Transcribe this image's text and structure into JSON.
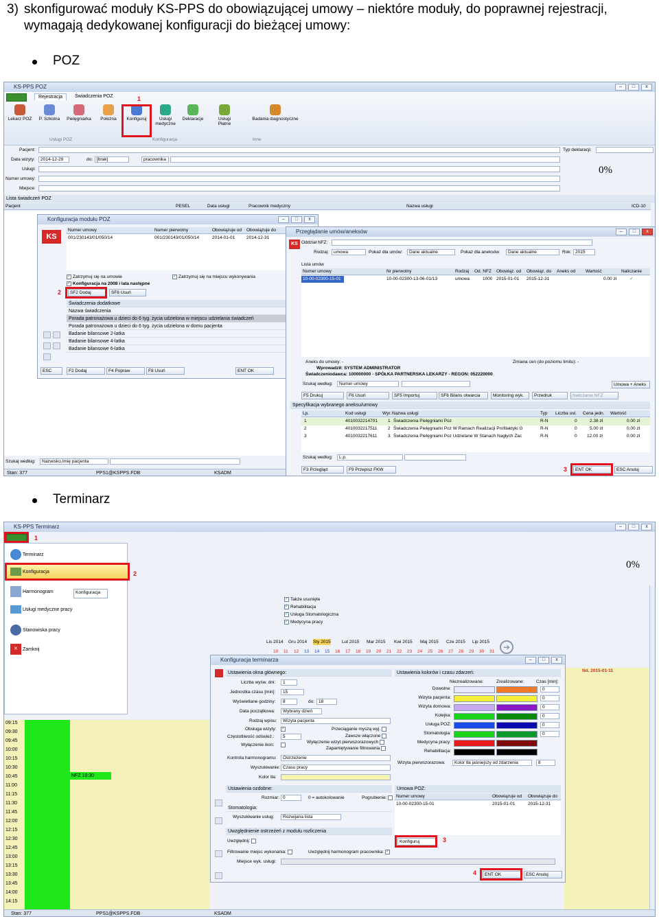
{
  "heading": {
    "number": "3)",
    "text": "skonfigurować moduły KS-PPS do obowiązującej umowy – niektóre moduły, do poprawnej rejestracji, wymagają dedykowanej konfiguracji do bieżącej umowy:"
  },
  "bullets": [
    "POZ",
    "Terminarz"
  ],
  "shot1": {
    "title": "KS-PPS POZ",
    "tabs": [
      "Rejestracja",
      "Świadczenia POZ"
    ],
    "ribbon_buttons": [
      "Lekarz POZ",
      "P. Szkolna",
      "Pielęgniarka",
      "Położna",
      "Konfiguruj",
      "Usługi medyczne",
      "Deklaracje",
      "Usługi Płatne",
      "Badania diagnostyczne"
    ],
    "groups": [
      "Usługi POZ",
      "Konfiguracja",
      "Inne"
    ],
    "form_labels": [
      "Pacjent:",
      "Data wizyty:",
      "Usługi:",
      "Numer umowy:",
      "Miejsce:"
    ],
    "date_from": "2014-12-29",
    "date_to_label": "do:",
    "date_to": "[brak]",
    "pracownik": "pracownika",
    "typ_deklaracji": "Typ deklaracji:",
    "percent": "0%",
    "list_title": "Lista świadczeń POZ",
    "list_cols": [
      "Pacjent",
      "PESEL",
      "Data usługi",
      "Pracownik medyczny",
      "Nazwa usługi",
      "ICD-10"
    ],
    "search_label": "Szukaj według:",
    "search_value": "Nazwisko,Imię pacjenta",
    "status": [
      "Stan: 377",
      "PPS1@KSPPS.FDB",
      "KSADM"
    ],
    "config": {
      "title": "Konfiguracja modułu POZ",
      "cols": [
        "Numer umowy",
        "Numer pierwotny",
        "Obowiązuje od",
        "Obowiązuje do"
      ],
      "row": [
        "001/230143/01/050/14",
        "001/230143/01/050/14",
        "2014-01-01",
        "2014-12-31"
      ],
      "chk1": "Zatrzymuj się na umowie",
      "chk2": "Zatrzymuj się na miejscu wykonywania",
      "chk3": "Konfiguracja na 2008 i lata następne",
      "add_btn": "SF2 Dodaj",
      "del_btn": "SF8 Usuń",
      "section": "Świadczenia dodatkowe",
      "list_hdr": "Nazwa świadczenia",
      "items": [
        "Porada patronażowa u dzieci do 6 tyg. życia udzielona w miejscu udzielania świadczeń",
        "Porada patronażowa u dzieci do 6 tyg. życia udzielona w domu pacjenta",
        "Badanie bilansowe 2-latka",
        "Badanie bilansowe 4-latka",
        "Badanie bilansowe 6-latka"
      ],
      "footer": [
        "ESC",
        "F2 Dodaj",
        "F4 Popraw",
        "F8 Usuń",
        "ENT OK"
      ]
    },
    "contracts": {
      "title": "Przeglądanie umów/aneksów",
      "oddzial": "Oddział NFZ:",
      "rodzaj_label": "Rodzaj:",
      "rodzaj": "umowa",
      "pokaz_umow": "Pokaż dla umów:",
      "pokaz_umow_val": "Dane aktualne",
      "pokaz_aneks": "Pokaż dla aneksów:",
      "pokaz_aneks_val": "Dane aktualne",
      "rok_label": "Rok:",
      "rok": "2015",
      "list_title": "Lista umów",
      "cols": [
        "Numer umowy",
        "Nr pierwotny",
        "Rodzaj",
        "Od. NFZ",
        "Obowiąz. od",
        "Obowiąz. do",
        "Aneks od",
        "Wartość",
        "Naliczanie"
      ],
      "row": [
        "10-00-02300-15-01",
        "10-00-02300-13-06-01/13",
        "umowa",
        "1000",
        "2015-01-01",
        "2015-12-31",
        "",
        "0.00 zł"
      ],
      "aneks_info": "Aneks do umowy: -",
      "zmiana_cen": "Zmiana cen (do poziomu limitu): -",
      "wprowadzil": "Wprowadził: SYSTEM ADMINISTRATOR",
      "swiadczeniodawca": "Świadczeniodawca: 100000000 - SPÓŁKA PARTNERSKA LEKARZY - REGON: 052220000",
      "szukaj": "Szukaj według:",
      "szukaj_val": "Numer umowy",
      "umowa_aneks": "Umowa + Aneks",
      "toolbar": [
        "F5 Drukuj",
        "F6 Usuń",
        "SF5 Importuj",
        "SF6 Bilans otwarcia",
        "Monitoring wyk.",
        "Przedruk",
        "Naliczanie NFZ"
      ],
      "spec_title": "Specyfikacja wybranego aneksu/umowy",
      "spec_cols": [
        "Lp.",
        "Kod usługi",
        "Wyr.",
        "Nazwa usługi",
        "Typ",
        "Liczba usł.",
        "Cena jedn.",
        "Wartość"
      ],
      "spec_rows": [
        [
          "1",
          "4010032214701",
          "1",
          "Świadczenia Pielęgniarki Poz",
          "R-N",
          "0",
          "2.38 zł",
          "0.00 zł"
        ],
        [
          "2",
          "4010032217511",
          "2",
          "Świadczenia Pielęgniarki Poz W Ramach Realizacji Profilaktyki G",
          "R-N",
          "0",
          "5.00 zł",
          "0.00 zł"
        ],
        [
          "3",
          "4010032217611",
          "3",
          "Świadczenia Pielęgniarki Poz Udzielane W Stanach Nagłych Zac",
          "R-N",
          "0",
          "12.00 zł",
          "0.00 zł"
        ]
      ],
      "spec_search": "Szukaj według:",
      "spec_search_val": "L.p.",
      "footer": [
        "F3 Przegląd",
        "F9 Przepisz FKW",
        "ENT OK",
        "ESC Anuluj"
      ]
    },
    "markers": [
      "1",
      "2",
      "3"
    ]
  },
  "shot2": {
    "title": "KS-PPS Terminarz",
    "menu": [
      "Terminarz",
      "Konfiguracja",
      "Harmonogram",
      "Usługi medyczne pracy",
      "Stanowiska pracy",
      "Zamknij"
    ],
    "tooltip": "Konfiguracja",
    "percent": "0%",
    "checks": [
      "Także usunięte",
      "Rehabilitacja",
      "Usługa Stomatologiczna",
      "Medycyna pracy"
    ],
    "months": [
      "Lis 2014",
      "Gru 2014",
      "Sty 2015",
      "Lut 2015",
      "Mar 2015",
      "Kwi 2015",
      "Maj 2015",
      "Cze 2015",
      "Lip 2015"
    ],
    "days": [
      "10",
      "11",
      "12",
      "13",
      "14",
      "15",
      "16",
      "17",
      "18",
      "19",
      "20",
      "21",
      "22",
      "23",
      "24",
      "25",
      "26",
      "27",
      "28",
      "29",
      "30",
      "31"
    ],
    "date_right": "Nd. 2015-01-11",
    "times": [
      "09:15",
      "09:30",
      "09:45",
      "10:00",
      "10:15",
      "10:30",
      "10:45",
      "11:00",
      "11:15",
      "11:30",
      "11:45",
      "12:00",
      "12:15",
      "12:30",
      "12:45",
      "13:00",
      "13:15",
      "13:30",
      "13:45",
      "14:00",
      "14:15"
    ],
    "nfz": "NFZ 10:30",
    "status": [
      "Stan: 377",
      "PPS1@KSPPS.FDB",
      "KSADM"
    ],
    "dialog": {
      "title": "Konfiguracja terminarza",
      "left_title": "Ustawienia okna głównego:",
      "fields": [
        [
          "Liczba wyśw. dni:",
          "1"
        ],
        [
          "Jednostka czasu [min]:",
          "15"
        ],
        [
          "Wyświetlane godziny:",
          "8"
        ],
        [
          "Data początkowa:",
          "Wybrany dzień"
        ],
        [
          "Rodzaj wpisu:",
          "Wizyta pacjenta"
        ]
      ],
      "do_label": "do:",
      "do_val": "18",
      "obsluga": "Obsługa wizyty:",
      "czestotliwosc": "Częstotliwość odśwież.:",
      "czest_val": "5",
      "wylaczenie": "Wyłączenie ikon:",
      "przeciaganie": "Przeciąganie myszą wyj.",
      "zawsze": "Zawsze włączone",
      "wylacz_wizyt": "Wyłączenie wizyt pierwszorazowych",
      "zapamietywanie": "Zapamiętywanie filtrowania",
      "kontrola": "Kontrola harmonogramu:",
      "kontrola_val": "Ostrzeżenie",
      "wyszukiwanie": "Wyszukiwanie:",
      "wysz_val": "Czasu pracy",
      "kolor_tla": "Kolor tła:",
      "ozdob_title": "Ustawienia ozdobne:",
      "rozmiar": "Rozmiar:",
      "rozmiar_val": "0",
      "auto": "0 = autokolowanie",
      "pogrubienie": "Pogrubienie:",
      "stomat": "Stomatologia:",
      "wysz_uslug": "Wyszukiwanie usług:",
      "wysz_uslug_val": "Rozwijana lista",
      "uwzgl_title": "Uwzględnienie ostrzeżeń z modułu rozliczenia",
      "uwzgledniaj": "Uwzględnij:",
      "filtr": "Filtrowanie miejsc wykonania:",
      "uwzgl_harm": "Uwzględnij harmonogram pracownika:",
      "miejsce": "Miejsce wyk. usługi:",
      "colors_title": "Ustawienia kolorów i czasu zdarzeń:",
      "col_heads": [
        "Niezrealizowane:",
        "Zrealizowane:",
        "Czas [min]:"
      ],
      "color_rows": [
        {
          "label": "Dowolne:",
          "a": "#e8e8f8",
          "b": "#f07b2a",
          "t": "0"
        },
        {
          "label": "Wizyta pacjenta:",
          "a": "#f4f03a",
          "b": "#f4f03a",
          "t": "0"
        },
        {
          "label": "Wizyta domowa:",
          "a": "#c8a8f0",
          "b": "#8a1ac8",
          "t": "0"
        },
        {
          "label": "Kolejka:",
          "a": "#1ad41a",
          "b": "#0a8a0a",
          "t": "0"
        },
        {
          "label": "Usługa POZ:",
          "a": "#1a4ae8",
          "b": "#0a0ab0",
          "t": "0"
        },
        {
          "label": "Stomatologia:",
          "a": "#1ad41a",
          "b": "#0a9a2a",
          "t": "0"
        },
        {
          "label": "Medycyna pracy:",
          "a": "#e81a1a",
          "b": "#800a0a",
          "t": ""
        },
        {
          "label": "Rehabilitacja:",
          "a": "#000000",
          "b": "#000000",
          "t": ""
        }
      ],
      "wizyta_pierwsza": "Wizyta pierwszorazowa:",
      "kolor_jasniejszy": "Kolor tła jaśniejszy od zdarzenia",
      "wizyta_val": "8",
      "umowa_title": "Umowa POZ:",
      "umowa_cols": [
        "Numer umowy",
        "Obowiązuje od",
        "Obowiązuje do"
      ],
      "umowa_row": [
        "10-00-02300-15-01",
        "2015-01-01",
        "2015-12-31"
      ],
      "konfiguruj": "Konfiguruj",
      "footer": [
        "ENT OK",
        "ESC Anuluj"
      ]
    },
    "markers": [
      "1",
      "2",
      "3",
      "4"
    ]
  }
}
